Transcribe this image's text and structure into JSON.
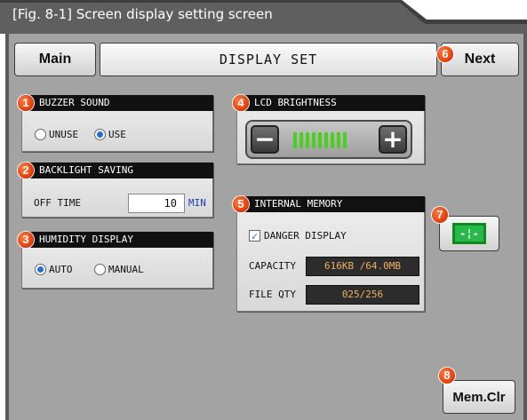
{
  "figure_title": "[Fig. 8-1] Screen display setting screen",
  "header": {
    "main_label": "Main",
    "title": "DISPLAY SET",
    "next_label": "Next"
  },
  "markers": [
    "1",
    "2",
    "3",
    "4",
    "5",
    "6",
    "7",
    "8"
  ],
  "buzzer": {
    "title": "BUZZER SOUND",
    "options": [
      "UNUSE",
      "USE"
    ],
    "selected": "USE"
  },
  "backlight": {
    "title": "BACKLIGHT SAVING",
    "label": "OFF TIME",
    "value": "10",
    "unit": "MIN"
  },
  "humidity": {
    "title": "HUMIDITY DISPLAY",
    "options": [
      "AUTO",
      "MANUAL"
    ],
    "selected": "AUTO"
  },
  "lcd": {
    "title": "LCD BRIGHTNESS",
    "minus": "−",
    "plus": "+",
    "level_bars": 9
  },
  "memory": {
    "title": "INTERNAL MEMORY",
    "danger_label": "DANGER DISPLAY",
    "danger_checked": true,
    "capacity_label": "CAPACITY",
    "capacity_value": "616KB /64.0MB",
    "fileqty_label": "FILE QTY",
    "fileqty_value": "025/256"
  },
  "monitor_button_glyph": "-¦-",
  "memclr_label": "Mem.Clr",
  "colors": {
    "badge": "#e23a06",
    "screen_bg": "#a3a3a3",
    "level_green": "#49d11d",
    "field_text": "#f0b060",
    "unit_blue": "#1a3ab8"
  }
}
